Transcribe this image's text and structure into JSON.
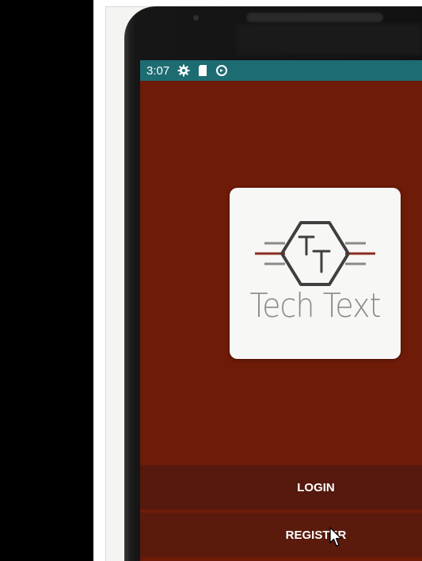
{
  "status_bar": {
    "time": "3:07",
    "icons": [
      "gear-icon",
      "sd-card-icon",
      "sync-icon"
    ],
    "background": "#1d6c72"
  },
  "app": {
    "background": "#6e1b08",
    "logo": {
      "monogram": "TT",
      "name": "Tech Text",
      "accent": "#8b2b20",
      "line_color": "#8a8a8a"
    },
    "buttons": {
      "login_label": "LOGIN",
      "register_label": "REGISTER"
    }
  }
}
